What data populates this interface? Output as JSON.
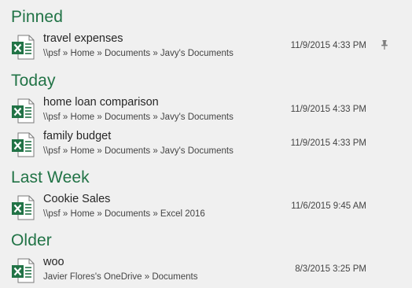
{
  "colors": {
    "accent": "#217346",
    "background": "#f0f0f0",
    "text_primary": "#262626",
    "text_secondary": "#444444"
  },
  "groups": [
    {
      "label": "Pinned",
      "files": [
        {
          "name": "travel expenses",
          "path": "\\\\psf » Home » Documents » Javy's Documents",
          "date": "11/9/2015 4:33 PM",
          "pinned": true,
          "icon": "excel-file-icon"
        }
      ]
    },
    {
      "label": "Today",
      "files": [
        {
          "name": "home loan comparison",
          "path": "\\\\psf » Home » Documents » Javy's Documents",
          "date": "11/9/2015 4:33 PM",
          "pinned": false,
          "icon": "excel-file-icon"
        },
        {
          "name": "family budget",
          "path": "\\\\psf » Home » Documents » Javy's Documents",
          "date": "11/9/2015 4:33 PM",
          "pinned": false,
          "icon": "excel-file-icon"
        }
      ]
    },
    {
      "label": "Last Week",
      "files": [
        {
          "name": "Cookie Sales",
          "path": "\\\\psf » Home » Documents » Excel 2016",
          "date": "11/6/2015 9:45 AM",
          "pinned": false,
          "icon": "excel-file-icon"
        }
      ]
    },
    {
      "label": "Older",
      "files": [
        {
          "name": "woo",
          "path": "Javier Flores's OneDrive » Documents",
          "date": "8/3/2015 3:25 PM",
          "pinned": false,
          "icon": "excel-file-icon"
        }
      ]
    }
  ]
}
